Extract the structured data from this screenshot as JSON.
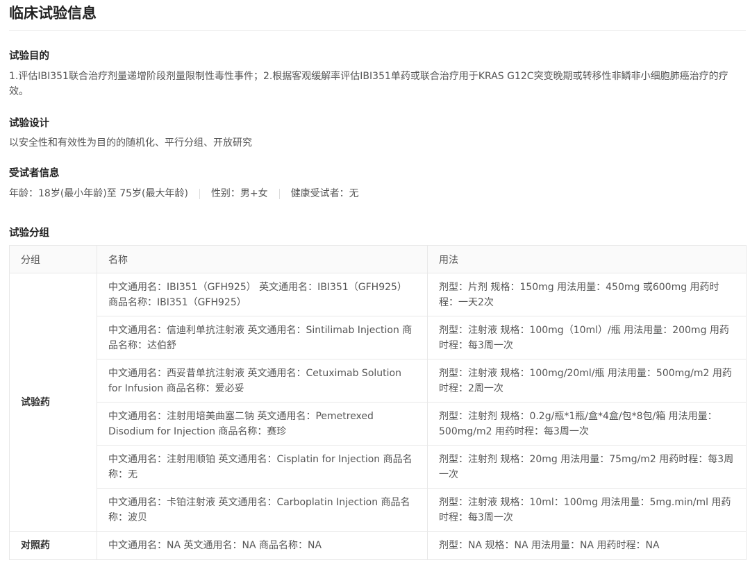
{
  "page": {
    "title": "临床试验信息"
  },
  "objective": {
    "heading": "试验目的",
    "text": "1.评估IBI351联合治疗剂量递增阶段剂量限制性毒性事件；2.根据客观缓解率评估IBI351单药或联合治疗用于KRAS G12C突变晚期或转移性非鳞非小细胞肺癌治疗的疗效。"
  },
  "design": {
    "heading": "试验设计",
    "text": "以安全性和有效性为目的的随机化、平行分组、开放研究"
  },
  "subjects": {
    "heading": "受试者信息",
    "age": "年龄：18岁(最小年龄)至 75岁(最大年龄)",
    "gender": "性别：男+女",
    "healthy": "健康受试者：无"
  },
  "arms": {
    "heading": "试验分组",
    "columns": [
      "分组",
      "名称",
      "用法"
    ],
    "test_group_label": "试验药",
    "control_group_label": "对照药",
    "test_drugs": [
      {
        "name": "中文通用名：IBI351（GFH925） 英文通用名：IBI351（GFH925） 商品名称：IBI351（GFH925）",
        "usage": "剂型：片剂 规格：150mg 用法用量：450mg 或600mg 用药时程：一天2次"
      },
      {
        "name": "中文通用名：信迪利单抗注射液 英文通用名：Sintilimab Injection 商品名称：达伯舒",
        "usage": "剂型：注射液 规格：100mg（10ml）/瓶 用法用量：200mg 用药时程：每3周一次"
      },
      {
        "name": "中文通用名：西妥昔单抗注射液 英文通用名：Cetuximab Solution for Infusion 商品名称：爱必妥",
        "usage": "剂型：注射液 规格：100mg/20ml/瓶 用法用量：500mg/m2 用药时程：2周一次"
      },
      {
        "name": "中文通用名：注射用培美曲塞二钠 英文通用名：Pemetrexed Disodium for Injection 商品名称：赛珍",
        "usage": "剂型：注射剂 规格：0.2g/瓶*1瓶/盒*4盒/包*8包/箱 用法用量：500mg/m2 用药时程：每3周一次"
      },
      {
        "name": "中文通用名：注射用顺铂 英文通用名：Cisplatin for Injection 商品名称：无",
        "usage": "剂型：注射剂 规格：20mg 用法用量：75mg/m2 用药时程：每3周一次"
      },
      {
        "name": "中文通用名：卡铂注射液 英文通用名：Carboplatin Injection 商品名称：波贝",
        "usage": "剂型：注射液 规格：10ml：100mg 用法用量：5mg.min/ml 用药时程：每3周一次"
      }
    ],
    "control_drugs": [
      {
        "name": "中文通用名：NA 英文通用名：NA 商品名称：NA",
        "usage": "剂型：NA 规格：NA 用法用量：NA 用药时程：NA"
      }
    ]
  }
}
